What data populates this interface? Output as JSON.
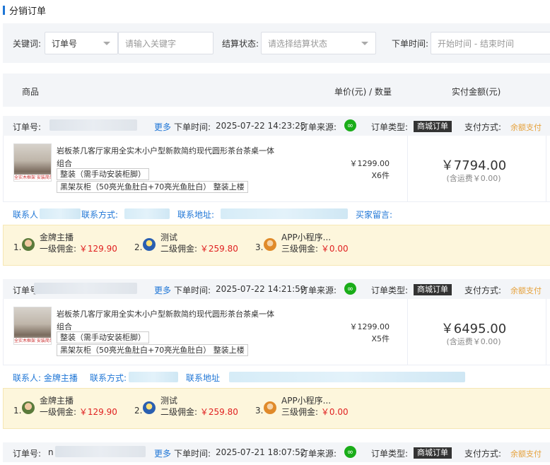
{
  "page_title": "分销订单",
  "filter": {
    "keyword_label": "关键词:",
    "keyword_type": "订单号",
    "keyword_placeholder": "请输入关键字",
    "settle_label": "结算状态:",
    "settle_placeholder": "请选择结算状态",
    "time_label": "下单时间:",
    "time_placeholder": "开始时间 - 结束时间"
  },
  "table_header": {
    "product": "商品",
    "price_qty": "单价(元) / 数量",
    "paid": "实付金额(元)"
  },
  "labels": {
    "order_no": "订单号:",
    "more": "更多",
    "order_time": "下单时间:",
    "source": "订单来源:",
    "order_type": "订单类型:",
    "pay_method": "支付方式:",
    "contact_phone": "联系方式:",
    "contact_addr": "联系地址:",
    "buyer_msg": "买家留言:",
    "contact_person": "联系人"
  },
  "orders": [
    {
      "order_no_prefix": "",
      "time": "2025-07-22 14:23:25",
      "type": "商城订单",
      "pay": "余额支付",
      "product_name": "岩板茶几客厅家用全实木小户型新款简约现代圆形茶台茶桌一体",
      "product_sub": "组合",
      "spec1": "整装（需手动安装柜脚）",
      "spec2": "黑架灰柜（50亮光鱼肚白+70亮光鱼肚白） 整装上楼",
      "thumb_caption": "全实木框架 安装简单",
      "unit_price": "￥1299.00",
      "qty": "X6件",
      "amount": "￥7794.00",
      "shipping": "(含运费￥0.00)",
      "contact_person": "联系人",
      "contact_phone_label": "联系方式:",
      "contact_addr_label": "联系地址:",
      "buyer_msg": "买家留言:",
      "commissions": [
        {
          "idx": "1.",
          "name": "金牌主播",
          "level": "一级佣金:",
          "money": "￥129.90"
        },
        {
          "idx": "2.",
          "name": "测试",
          "level": "二级佣金:",
          "money": "￥259.80"
        },
        {
          "idx": "3.",
          "name": "APP小程序...",
          "level": "三级佣金:",
          "money": "￥0.00"
        }
      ]
    },
    {
      "order_no_prefix": "",
      "time": "2025-07-22 14:21:59",
      "type": "商城订单",
      "pay": "余额支付",
      "product_name": "岩板茶几客厅家用全实木小户型新款简约现代圆形茶台茶桌一体",
      "product_sub": "组合",
      "spec1": "整装（需手动安装柜脚）",
      "spec2": "黑架灰柜（50亮光鱼肚白+70亮光鱼肚白） 整装上楼",
      "thumb_caption": "全实木框架 安装简单",
      "unit_price": "￥1299.00",
      "qty": "X5件",
      "amount": "￥6495.00",
      "shipping": "(含运费￥0.00)",
      "contact_person": "联系人: 金牌主播",
      "contact_phone_label": "联系方式:",
      "contact_addr_label": "联系地址",
      "buyer_msg": "",
      "commissions": [
        {
          "idx": "1.",
          "name": "金牌主播",
          "level": "一级佣金:",
          "money": "￥129.90"
        },
        {
          "idx": "2.",
          "name": "测试",
          "level": "二级佣金:",
          "money": "￥259.80"
        },
        {
          "idx": "3.",
          "name": "APP小程序...",
          "level": "三级佣金:",
          "money": "￥0.00"
        }
      ]
    },
    {
      "order_no_prefix": "n",
      "time": "2025-07-21 18:07:52",
      "type": "商城订单",
      "pay": "余额支付"
    }
  ],
  "colors": {
    "accent": "#1f76d6",
    "wechat": "#1aad19",
    "money": "#e02020",
    "pay": "#e6a23c",
    "commission_bg": "#fdf6dc"
  }
}
